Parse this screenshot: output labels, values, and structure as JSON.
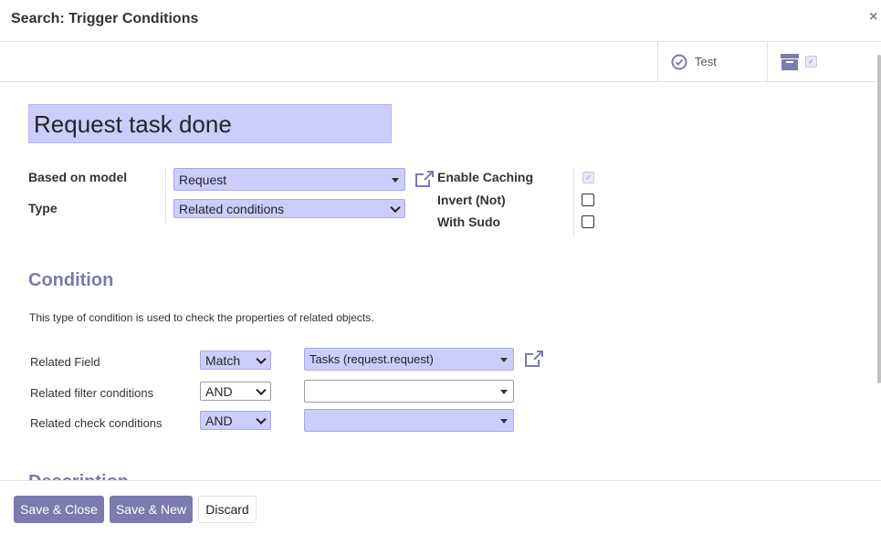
{
  "dialog": {
    "title": "Search: Trigger Conditions"
  },
  "button_box": {
    "test_label": "Test"
  },
  "form": {
    "name": "Request task done",
    "based_on_model_label": "Based on model",
    "based_on_model_value": "Request",
    "type_label": "Type",
    "type_value": "Related conditions",
    "enable_caching_label": "Enable Caching",
    "enable_caching_checked": true,
    "invert_label": "Invert (Not)",
    "invert_checked": false,
    "with_sudo_label": "With Sudo",
    "with_sudo_checked": false
  },
  "condition": {
    "section_title": "Condition",
    "description": "This type of condition is used to check the properties of related objects.",
    "rows": [
      {
        "label": "Related Field",
        "operator": "Match",
        "value": "Tasks (request.request)"
      },
      {
        "label": "Related filter conditions",
        "operator": "AND",
        "value": ""
      },
      {
        "label": "Related check conditions",
        "operator": "AND",
        "value": ""
      }
    ]
  },
  "next_section_title": "Description",
  "footer": {
    "save_close": "Save & Close",
    "save_new": "Save & New",
    "discard": "Discard"
  },
  "colors": {
    "primary": "#7c7bad",
    "field_bg": "#cdcdfb"
  }
}
